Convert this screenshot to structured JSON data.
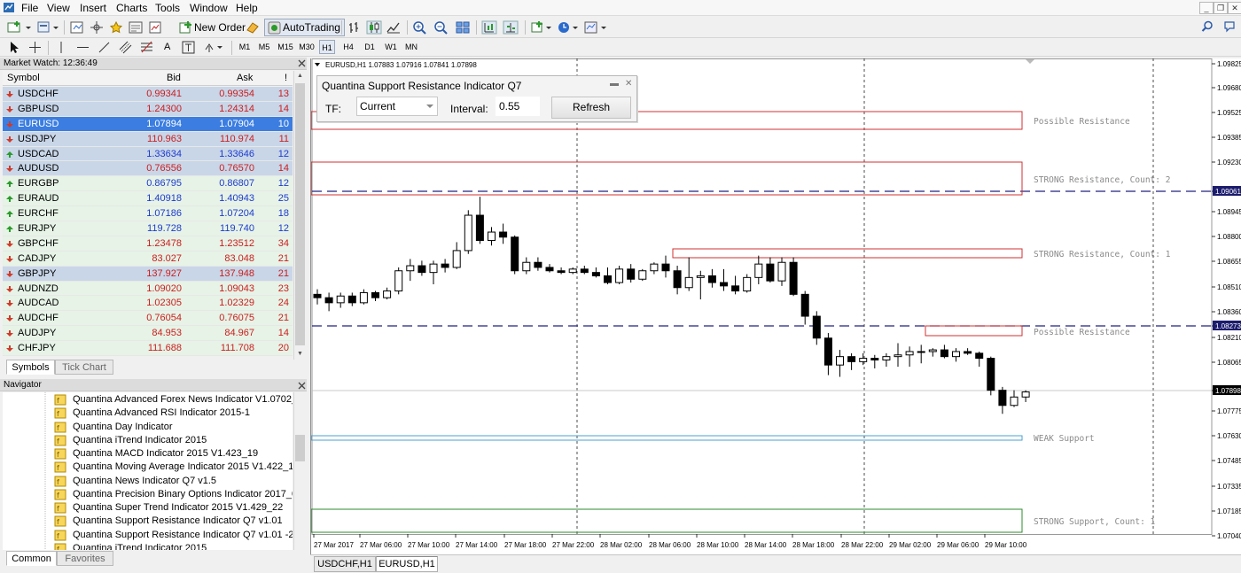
{
  "menu": {
    "items": [
      "File",
      "View",
      "Insert",
      "Charts",
      "Tools",
      "Window",
      "Help"
    ]
  },
  "toolbar": {
    "new_order_label": "New Order",
    "autotrading_label": "AutoTrading",
    "timeframes": [
      "M1",
      "M5",
      "M15",
      "M30",
      "H1",
      "H4",
      "D1",
      "W1",
      "MN"
    ]
  },
  "market_watch": {
    "title": "Market Watch: 12:36:49",
    "col_symbol": "Symbol",
    "col_bid": "Bid",
    "col_ask": "Ask",
    "col_spread": "!",
    "rows": [
      {
        "symbol": "USDCHF",
        "bid": "0.99341",
        "ask": "0.99354",
        "spread": "13",
        "dir": "down",
        "bg": "blue"
      },
      {
        "symbol": "GBPUSD",
        "bid": "1.24300",
        "ask": "1.24314",
        "spread": "14",
        "dir": "down",
        "bg": "blue"
      },
      {
        "symbol": "EURUSD",
        "bid": "1.07894",
        "ask": "1.07904",
        "spread": "10",
        "dir": "down",
        "bg": "sel"
      },
      {
        "symbol": "USDJPY",
        "bid": "110.963",
        "ask": "110.974",
        "spread": "11",
        "dir": "down",
        "bg": "blue"
      },
      {
        "symbol": "USDCAD",
        "bid": "1.33634",
        "ask": "1.33646",
        "spread": "12",
        "dir": "up",
        "bg": "blue"
      },
      {
        "symbol": "AUDUSD",
        "bid": "0.76556",
        "ask": "0.76570",
        "spread": "14",
        "dir": "down",
        "bg": "blue"
      },
      {
        "symbol": "EURGBP",
        "bid": "0.86795",
        "ask": "0.86807",
        "spread": "12",
        "dir": "up",
        "bg": "green"
      },
      {
        "symbol": "EURAUD",
        "bid": "1.40918",
        "ask": "1.40943",
        "spread": "25",
        "dir": "up",
        "bg": "green"
      },
      {
        "symbol": "EURCHF",
        "bid": "1.07186",
        "ask": "1.07204",
        "spread": "18",
        "dir": "up",
        "bg": "green"
      },
      {
        "symbol": "EURJPY",
        "bid": "119.728",
        "ask": "119.740",
        "spread": "12",
        "dir": "up",
        "bg": "green"
      },
      {
        "symbol": "GBPCHF",
        "bid": "1.23478",
        "ask": "1.23512",
        "spread": "34",
        "dir": "down",
        "bg": "green"
      },
      {
        "symbol": "CADJPY",
        "bid": "83.027",
        "ask": "83.048",
        "spread": "21",
        "dir": "down",
        "bg": "green"
      },
      {
        "symbol": "GBPJPY",
        "bid": "137.927",
        "ask": "137.948",
        "spread": "21",
        "dir": "down",
        "bg": "blue"
      },
      {
        "symbol": "AUDNZD",
        "bid": "1.09020",
        "ask": "1.09043",
        "spread": "23",
        "dir": "down",
        "bg": "green"
      },
      {
        "symbol": "AUDCAD",
        "bid": "1.02305",
        "ask": "1.02329",
        "spread": "24",
        "dir": "down",
        "bg": "green"
      },
      {
        "symbol": "AUDCHF",
        "bid": "0.76054",
        "ask": "0.76075",
        "spread": "21",
        "dir": "down",
        "bg": "green"
      },
      {
        "symbol": "AUDJPY",
        "bid": "84.953",
        "ask": "84.967",
        "spread": "14",
        "dir": "down",
        "bg": "green"
      },
      {
        "symbol": "CHFJPY",
        "bid": "111.688",
        "ask": "111.708",
        "spread": "20",
        "dir": "down",
        "bg": "green"
      }
    ],
    "tabs": [
      "Symbols",
      "Tick Chart"
    ]
  },
  "navigator": {
    "title": "Navigator",
    "items": [
      "Quantina Advanced Forex News Indicator V1.0702_15",
      "Quantina Advanced RSI Indicator 2015-1",
      "Quantina Day Indicator",
      "Quantina iTrend Indicator 2015",
      "Quantina MACD Indicator 2015 V1.423_19",
      "Quantina Moving Average Indicator 2015 V1.422_15",
      "Quantina News Indicator Q7 v1.5",
      "Quantina Precision Binary Options Indicator 2017_090620",
      "Quantina Super Trend Indicator 2015 V1.429_22",
      "Quantina Support Resistance Indicator Q7 v1.01",
      "Quantina Support Resistance Indicator Q7 v1.01 -201703",
      "Quantina iTrend Indicator 2015"
    ],
    "tabs": [
      "Common",
      "Favorites"
    ]
  },
  "chart": {
    "header": "EURUSD,H1  1.07883 1.07916 1.07841 1.07898",
    "price_labels": [
      "1.09825",
      "1.09680",
      "1.09525",
      "1.09385",
      "1.09230",
      "1.09061",
      "1.08945",
      "1.08800",
      "1.08655",
      "1.08510",
      "1.08360",
      "1.08273",
      "1.08210",
      "1.08065",
      "1.07898",
      "1.07775",
      "1.07630",
      "1.07485",
      "1.07335",
      "1.07185",
      "1.07040"
    ],
    "current_price": "1.07898",
    "line_upper": "1.09061",
    "line_lower": "1.08273",
    "time_labels": [
      "27 Mar 2017",
      "27 Mar 06:00",
      "27 Mar 10:00",
      "27 Mar 14:00",
      "27 Mar 18:00",
      "27 Mar 22:00",
      "28 Mar 02:00",
      "28 Mar 06:00",
      "28 Mar 10:00",
      "28 Mar 14:00",
      "28 Mar 18:00",
      "28 Mar 22:00",
      "29 Mar 02:00",
      "29 Mar 06:00",
      "29 Mar 10:00"
    ],
    "zone_labels": [
      "Possible Resistance",
      "STRONG Resistance, Count: 2",
      "STRONG Resistance, Count: 1",
      "Possible Resistance",
      "WEAK Support",
      "STRONG Support, Count: 1"
    ],
    "tabs": [
      "USDCHF,H1",
      "EURUSD,H1"
    ],
    "colors": {
      "resistance": "#d03030",
      "weak_support": "#4aa0d0",
      "strong_support": "#2e8b2e",
      "dashed": "#202080"
    }
  },
  "indicator_panel": {
    "title": "Quantina Support Resistance Indicator Q7",
    "tf_label": "TF:",
    "tf_value": "Current",
    "interval_label": "Interval:",
    "interval_value": "0.55",
    "refresh_label": "Refresh"
  },
  "chart_data": {
    "type": "candlestick",
    "y_range": [
      1.0704,
      1.0985
    ],
    "candles": [
      {
        "o": 1.0848,
        "h": 1.0851,
        "l": 1.0842,
        "c": 1.0846
      },
      {
        "o": 1.0846,
        "h": 1.0849,
        "l": 1.0838,
        "c": 1.0843
      },
      {
        "o": 1.0843,
        "h": 1.0849,
        "l": 1.084,
        "c": 1.0847
      },
      {
        "o": 1.0847,
        "h": 1.0849,
        "l": 1.0841,
        "c": 1.0843
      },
      {
        "o": 1.0843,
        "h": 1.0851,
        "l": 1.0842,
        "c": 1.0849
      },
      {
        "o": 1.0849,
        "h": 1.085,
        "l": 1.0844,
        "c": 1.0846
      },
      {
        "o": 1.0846,
        "h": 1.0852,
        "l": 1.0845,
        "c": 1.085
      },
      {
        "o": 1.085,
        "h": 1.0864,
        "l": 1.0848,
        "c": 1.0862
      },
      {
        "o": 1.0862,
        "h": 1.0869,
        "l": 1.0856,
        "c": 1.0865
      },
      {
        "o": 1.0865,
        "h": 1.0868,
        "l": 1.0859,
        "c": 1.0861
      },
      {
        "o": 1.0861,
        "h": 1.0868,
        "l": 1.0854,
        "c": 1.0866
      },
      {
        "o": 1.0866,
        "h": 1.0869,
        "l": 1.0861,
        "c": 1.0864
      },
      {
        "o": 1.0864,
        "h": 1.0879,
        "l": 1.0863,
        "c": 1.0874
      },
      {
        "o": 1.0874,
        "h": 1.0898,
        "l": 1.0872,
        "c": 1.0895
      },
      {
        "o": 1.0895,
        "h": 1.0906,
        "l": 1.0878,
        "c": 1.088
      },
      {
        "o": 1.088,
        "h": 1.0888,
        "l": 1.0877,
        "c": 1.0885
      },
      {
        "o": 1.0885,
        "h": 1.089,
        "l": 1.0878,
        "c": 1.0882
      },
      {
        "o": 1.0882,
        "h": 1.0883,
        "l": 1.086,
        "c": 1.0862
      },
      {
        "o": 1.0862,
        "h": 1.087,
        "l": 1.086,
        "c": 1.0867
      },
      {
        "o": 1.0867,
        "h": 1.087,
        "l": 1.0862,
        "c": 1.0864
      },
      {
        "o": 1.0864,
        "h": 1.0866,
        "l": 1.0861,
        "c": 1.0862
      },
      {
        "o": 1.0862,
        "h": 1.0864,
        "l": 1.086,
        "c": 1.0861
      },
      {
        "o": 1.0861,
        "h": 1.0864,
        "l": 1.086,
        "c": 1.0863
      },
      {
        "o": 1.0863,
        "h": 1.0865,
        "l": 1.086,
        "c": 1.0861
      },
      {
        "o": 1.0861,
        "h": 1.0864,
        "l": 1.0858,
        "c": 1.0859
      },
      {
        "o": 1.0859,
        "h": 1.0864,
        "l": 1.0854,
        "c": 1.0855
      },
      {
        "o": 1.0855,
        "h": 1.0865,
        "l": 1.0854,
        "c": 1.0863
      },
      {
        "o": 1.0863,
        "h": 1.0866,
        "l": 1.0855,
        "c": 1.0857
      },
      {
        "o": 1.0857,
        "h": 1.0863,
        "l": 1.0856,
        "c": 1.0862
      },
      {
        "o": 1.0862,
        "h": 1.0867,
        "l": 1.086,
        "c": 1.0866
      },
      {
        "o": 1.0866,
        "h": 1.0871,
        "l": 1.0858,
        "c": 1.0862
      },
      {
        "o": 1.0862,
        "h": 1.0865,
        "l": 1.0848,
        "c": 1.0852
      },
      {
        "o": 1.0852,
        "h": 1.087,
        "l": 1.085,
        "c": 1.0858
      },
      {
        "o": 1.0858,
        "h": 1.0862,
        "l": 1.0845,
        "c": 1.0859
      },
      {
        "o": 1.0859,
        "h": 1.0863,
        "l": 1.0852,
        "c": 1.0855
      },
      {
        "o": 1.0855,
        "h": 1.0863,
        "l": 1.085,
        "c": 1.0853
      },
      {
        "o": 1.0853,
        "h": 1.0859,
        "l": 1.0848,
        "c": 1.085
      },
      {
        "o": 1.085,
        "h": 1.086,
        "l": 1.0849,
        "c": 1.0858
      },
      {
        "o": 1.0858,
        "h": 1.0871,
        "l": 1.0854,
        "c": 1.0866
      },
      {
        "o": 1.0866,
        "h": 1.087,
        "l": 1.0855,
        "c": 1.0856
      },
      {
        "o": 1.0856,
        "h": 1.087,
        "l": 1.0853,
        "c": 1.0867
      },
      {
        "o": 1.0867,
        "h": 1.087,
        "l": 1.0847,
        "c": 1.0848
      },
      {
        "o": 1.0848,
        "h": 1.085,
        "l": 1.083,
        "c": 1.0835
      },
      {
        "o": 1.0835,
        "h": 1.0838,
        "l": 1.0818,
        "c": 1.0822
      },
      {
        "o": 1.0822,
        "h": 1.0825,
        "l": 1.08,
        "c": 1.0806
      },
      {
        "o": 1.0806,
        "h": 1.0815,
        "l": 1.0799,
        "c": 1.0811
      },
      {
        "o": 1.0811,
        "h": 1.0813,
        "l": 1.0803,
        "c": 1.0808
      },
      {
        "o": 1.0808,
        "h": 1.0813,
        "l": 1.0806,
        "c": 1.081
      },
      {
        "o": 1.081,
        "h": 1.0812,
        "l": 1.0804,
        "c": 1.0809
      },
      {
        "o": 1.0809,
        "h": 1.0813,
        "l": 1.0805,
        "c": 1.0811
      },
      {
        "o": 1.0811,
        "h": 1.0819,
        "l": 1.0805,
        "c": 1.0812
      },
      {
        "o": 1.0812,
        "h": 1.0817,
        "l": 1.0805,
        "c": 1.0814
      },
      {
        "o": 1.0814,
        "h": 1.0818,
        "l": 1.0807,
        "c": 1.0814
      },
      {
        "o": 1.0814,
        "h": 1.0816,
        "l": 1.0811,
        "c": 1.0815
      },
      {
        "o": 1.0815,
        "h": 1.0818,
        "l": 1.081,
        "c": 1.0811
      },
      {
        "o": 1.0811,
        "h": 1.0816,
        "l": 1.0808,
        "c": 1.0814
      },
      {
        "o": 1.0814,
        "h": 1.0816,
        "l": 1.0812,
        "c": 1.0813
      },
      {
        "o": 1.0813,
        "h": 1.0814,
        "l": 1.0805,
        "c": 1.081
      },
      {
        "o": 1.081,
        "h": 1.0811,
        "l": 1.0788,
        "c": 1.0791
      },
      {
        "o": 1.0791,
        "h": 1.0793,
        "l": 1.0777,
        "c": 1.0782
      },
      {
        "o": 1.0782,
        "h": 1.0791,
        "l": 1.0781,
        "c": 1.0787
      },
      {
        "o": 1.0787,
        "h": 1.0791,
        "l": 1.0784,
        "c": 1.079
      }
    ]
  }
}
